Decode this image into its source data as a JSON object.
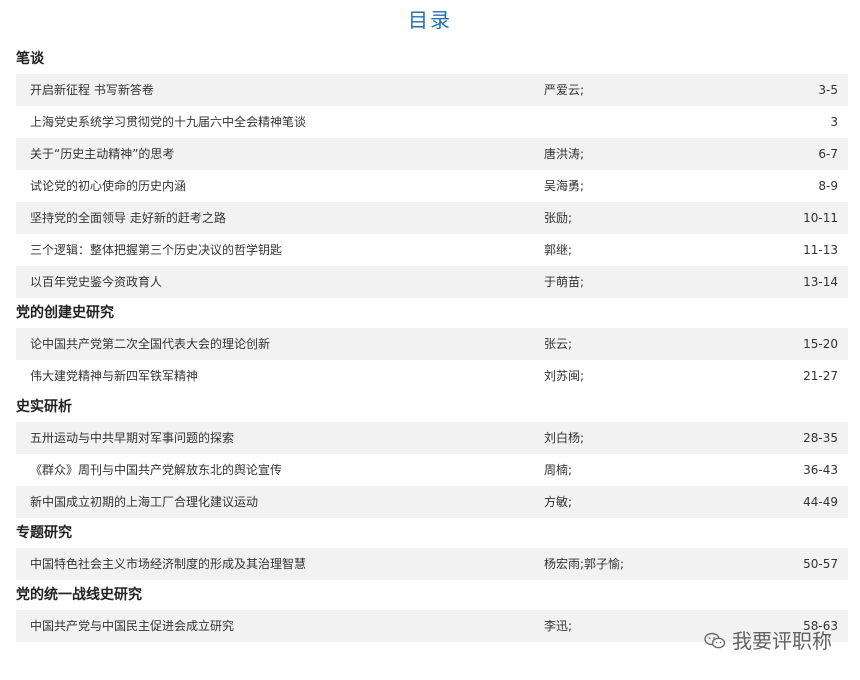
{
  "page": {
    "title": "目录"
  },
  "sections": [
    {
      "title": "笔谈",
      "items": [
        {
          "title": "开启新征程 书写新答卷",
          "author": "严爱云;",
          "pages": "3-5"
        },
        {
          "title": "上海党史系统学习贯彻党的十九届六中全会精神笔谈",
          "author": "",
          "pages": "3"
        },
        {
          "title": "关于“历史主动精神”的思考",
          "author": "唐洪涛;",
          "pages": "6-7"
        },
        {
          "title": "试论党的初心使命的历史内涵",
          "author": "吴海勇;",
          "pages": "8-9"
        },
        {
          "title": "坚持党的全面领导 走好新的赶考之路",
          "author": "张励;",
          "pages": "10-11"
        },
        {
          "title": "三个逻辑：整体把握第三个历史决议的哲学钥匙",
          "author": "郭继;",
          "pages": "11-13"
        },
        {
          "title": "以百年党史鉴今资政育人",
          "author": "于萌苗;",
          "pages": "13-14"
        }
      ]
    },
    {
      "title": "党的创建史研究",
      "items": [
        {
          "title": "论中国共产党第二次全国代表大会的理论创新",
          "author": "张云;",
          "pages": "15-20"
        },
        {
          "title": "伟大建党精神与新四军铁军精神",
          "author": "刘苏闽;",
          "pages": "21-27"
        }
      ]
    },
    {
      "title": "史实研析",
      "items": [
        {
          "title": "五卅运动与中共早期对军事问题的探索",
          "author": "刘白杨;",
          "pages": "28-35"
        },
        {
          "title": "《群众》周刊与中国共产党解放东北的舆论宣传",
          "author": "周楠;",
          "pages": "36-43"
        },
        {
          "title": "新中国成立初期的上海工厂合理化建议运动",
          "author": "方敏;",
          "pages": "44-49"
        }
      ]
    },
    {
      "title": "专题研究",
      "items": [
        {
          "title": "中国特色社会主义市场经济制度的形成及其治理智慧",
          "author": "杨宏雨;郭子愉;",
          "pages": "50-57"
        }
      ]
    },
    {
      "title": "党的统一战线史研究",
      "items": [
        {
          "title": "中国共产党与中国民主促进会成立研究",
          "author": "李迅;",
          "pages": "58-63"
        }
      ]
    }
  ],
  "watermark": {
    "text": "我要评职称",
    "icon": "wechat-icon"
  }
}
